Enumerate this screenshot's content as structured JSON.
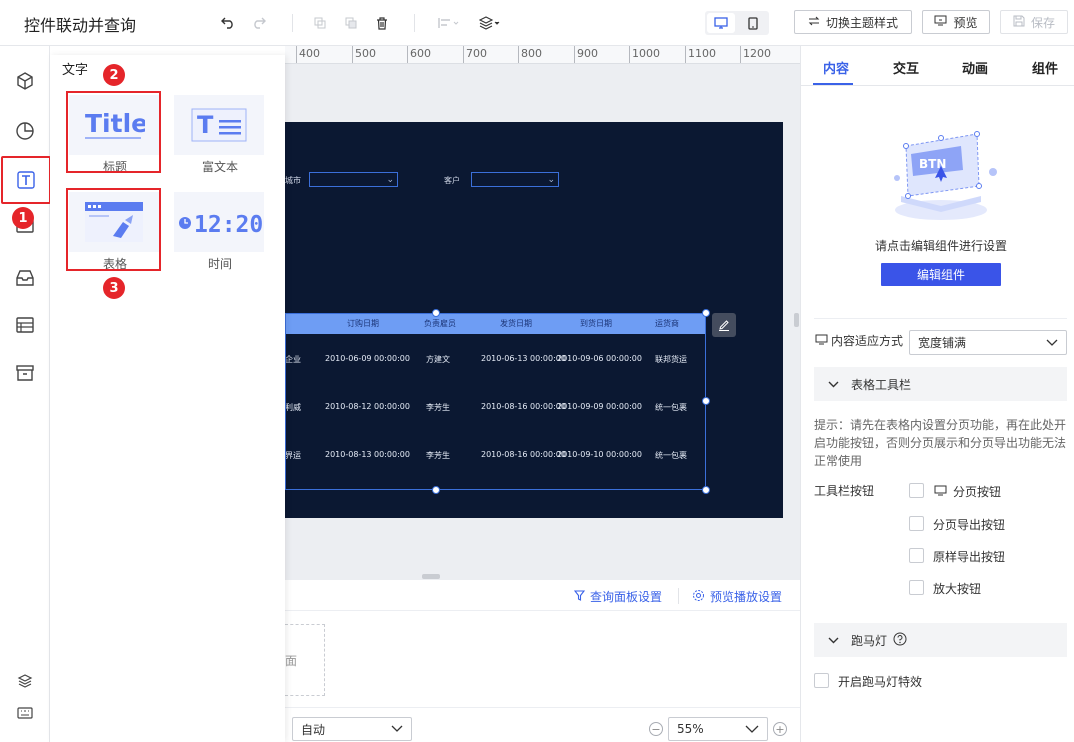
{
  "app_title": "控件联动并查询",
  "toolbar": {
    "undo_icon": "undo-icon",
    "redo_icon": "redo-icon",
    "switch_theme_label": "切换主题样式",
    "preview_label": "预览",
    "save_label": "保存"
  },
  "left_rail": {
    "items": [
      "3d-component",
      "chart",
      "text",
      "media",
      "container",
      "table",
      "archive"
    ],
    "bottom_items": [
      "layers",
      "keyboard"
    ]
  },
  "component_panel": {
    "title": "文字",
    "cards": [
      {
        "label": "标题",
        "thumb": "Title"
      },
      {
        "label": "富文本",
        "thumb": "T"
      },
      {
        "label": "表格",
        "thumb": ""
      },
      {
        "label": "时间",
        "thumb": "12:20"
      }
    ],
    "badges": [
      "1",
      "2",
      "3"
    ]
  },
  "ruler": {
    "labels": [
      "400",
      "500",
      "600",
      "700",
      "800",
      "900",
      "1000",
      "1100",
      "1200"
    ]
  },
  "canvas": {
    "filters": [
      {
        "label": "城市"
      },
      {
        "label": "客户"
      }
    ],
    "table": {
      "headers": [
        "订购日期",
        "负责雇员",
        "发货日期",
        "到货日期",
        "运货商"
      ],
      "rows": [
        {
          "prefix": "企业",
          "cells": [
            "2010-06-09 00:00:00",
            "方建文",
            "2010-06-13 00:00:00",
            "2010-09-06 00:00:00",
            "联邦货运"
          ]
        },
        {
          "prefix": "利威",
          "cells": [
            "2010-08-12 00:00:00",
            "李芳生",
            "2010-08-16 00:00:00",
            "2010-09-09 00:00:00",
            "统一包裹"
          ]
        },
        {
          "prefix": "界运",
          "cells": [
            "2010-08-13 00:00:00",
            "李芳生",
            "2010-08-16 00:00:00",
            "2010-09-10 00:00:00",
            "统一包裹"
          ]
        }
      ]
    }
  },
  "query_bar": {
    "panel_settings": "查询面板设置",
    "preview_play_settings": "预览播放设置",
    "drop_hint": "面"
  },
  "bottom_bar": {
    "fit_mode": "自动",
    "zoom": "55%"
  },
  "right_panel": {
    "tabs": [
      "内容",
      "交互",
      "动画",
      "组件"
    ],
    "hint": "请点击编辑组件进行设置",
    "edit_button": "编辑组件",
    "adapt_label": "内容适应方式",
    "adapt_value": "宽度铺满",
    "toolbar_section": "表格工具栏",
    "tip": [
      "提示：请先在表格内设置分页功能，再在此处开",
      "启功能按钮，否则分页展示和分页导出功能无法",
      "正常使用"
    ],
    "toolbar_buttons_label": "工具栏按钮",
    "options": [
      "分页按钮",
      "分页导出按钮",
      "原样导出按钮",
      "放大按钮"
    ],
    "marquee_section": "跑马灯",
    "marquee_option": "开启跑马灯特效"
  }
}
